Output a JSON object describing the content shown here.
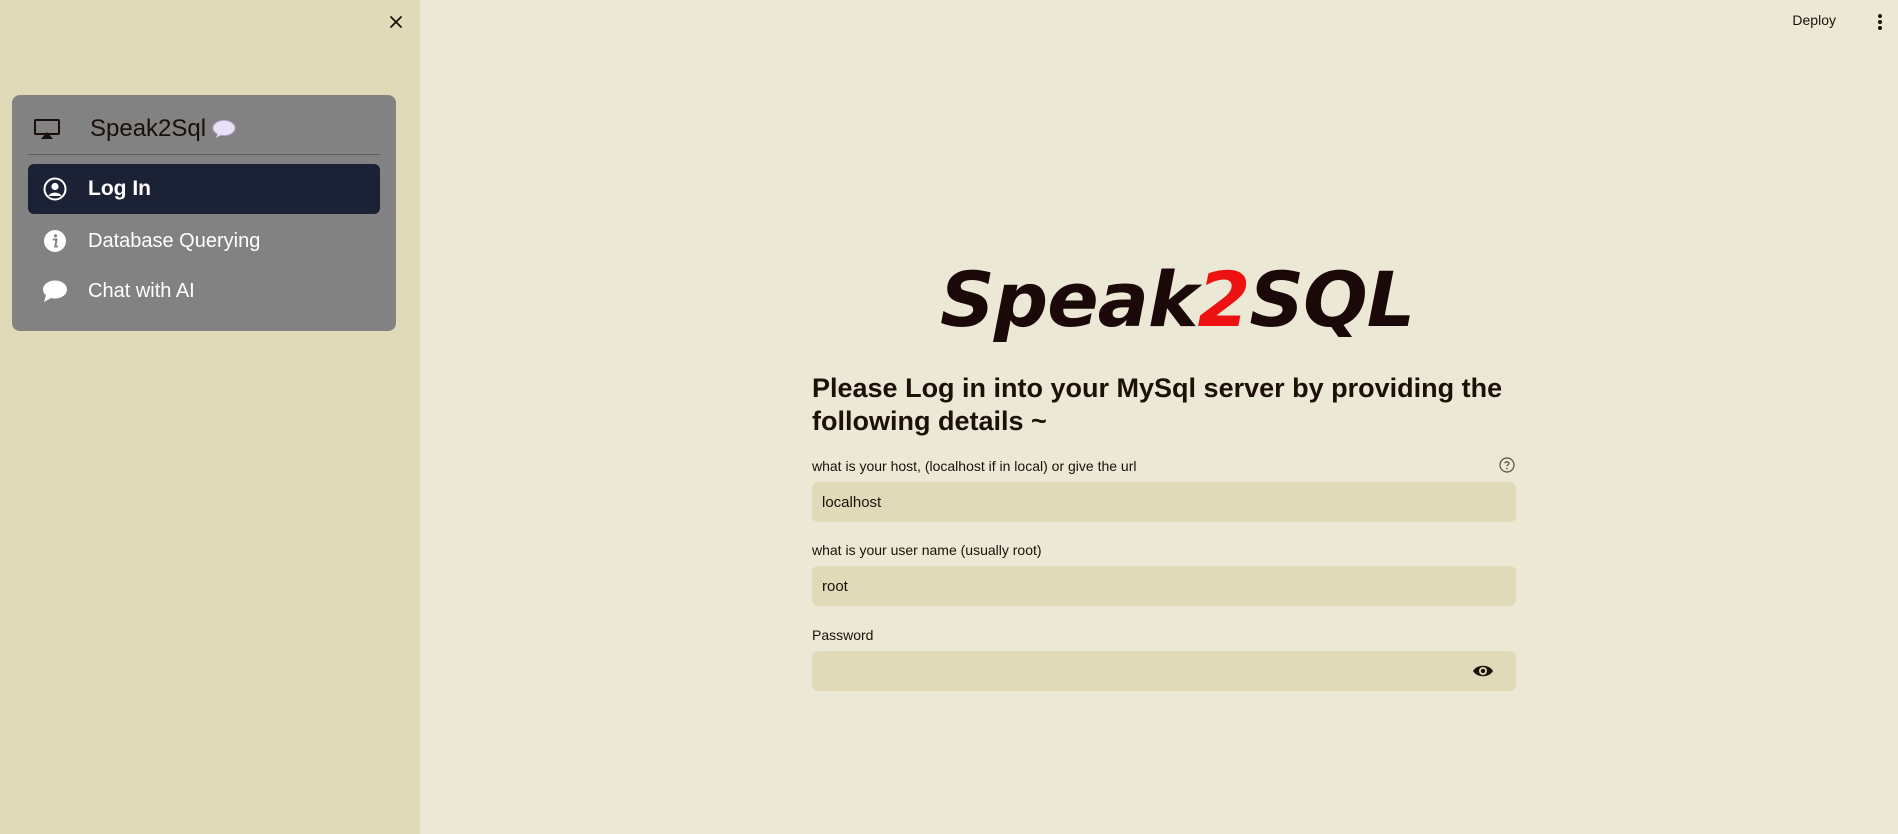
{
  "sidebar": {
    "app_title": "Speak2Sql",
    "items": [
      {
        "label": "Log In",
        "icon": "user-circle-icon",
        "active": true
      },
      {
        "label": "Database Querying",
        "icon": "info-icon",
        "active": false
      },
      {
        "label": "Chat with AI",
        "icon": "chat-bubble-icon",
        "active": false
      }
    ]
  },
  "header": {
    "deploy_label": "Deploy"
  },
  "main": {
    "logo": {
      "part1": "Speak",
      "accent": "2",
      "part2": "SQL"
    },
    "heading": "Please Log in into your MySql server by providing the following details ~",
    "fields": [
      {
        "label": "what is your host, (localhost if in local) or give the url",
        "value": "localhost"
      },
      {
        "label": "what is your user name (usually root)",
        "value": "root"
      },
      {
        "label": "Password",
        "value": ""
      }
    ]
  },
  "colors": {
    "sidebar_bg": "#e0dab8",
    "main_bg": "#ece8d6",
    "nav_card_bg": "#828282",
    "active_item_bg": "#1c2235",
    "logo_accent": "#ee1111"
  }
}
